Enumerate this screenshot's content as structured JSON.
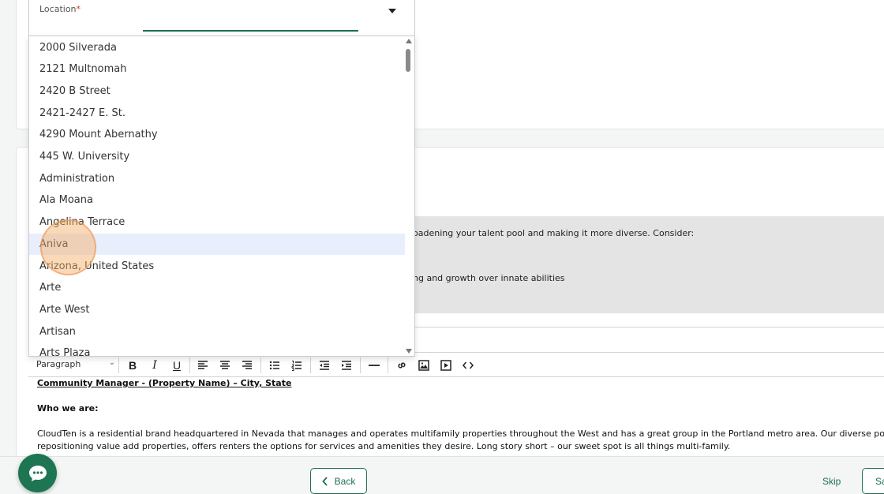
{
  "location_field": {
    "label": "Location",
    "required_marker": "*",
    "options": [
      "2000 Silverada",
      "2121 Multnomah",
      "2420 B Street",
      "2421-2427 E. St.",
      "4290 Mount Abernathy",
      "445 W. University",
      "Administration",
      "Ala Moana",
      "Angelina Terrace",
      "Aniva",
      "Arizona, United States",
      "Arte",
      "Arte West",
      "Artisan",
      "Arts Plaza"
    ],
    "highlighted_option": "Aniva"
  },
  "tip": {
    "line1": "oadening your talent pool and making it more diverse. Consider:",
    "line2": "ng and growth over innate abilities"
  },
  "toolbar": {
    "block_format": "Paragraph"
  },
  "editor": {
    "heading": "Community Manager - (Property Name) – City, State",
    "who_we_are": "Who we are:",
    "body_line1": "CloudTen is a residential brand headquartered in Nevada that manages and operates multifamily properties throughout the West and has a great group in the Portland metro area. Our diverse portfolio of properties",
    "body_line2": "repositioning value add properties, offers renters the options for services and amenities they desire. Long story short – our sweet spot is all things multi-family."
  },
  "footer": {
    "back_label": "Back",
    "skip_label": "Skip",
    "save_label": "Sa"
  },
  "colors": {
    "brand_green": "#1f6f53",
    "chat_green": "#1d7552",
    "highlight": "#e8eefc",
    "tip_background": "#e4e4e4"
  }
}
